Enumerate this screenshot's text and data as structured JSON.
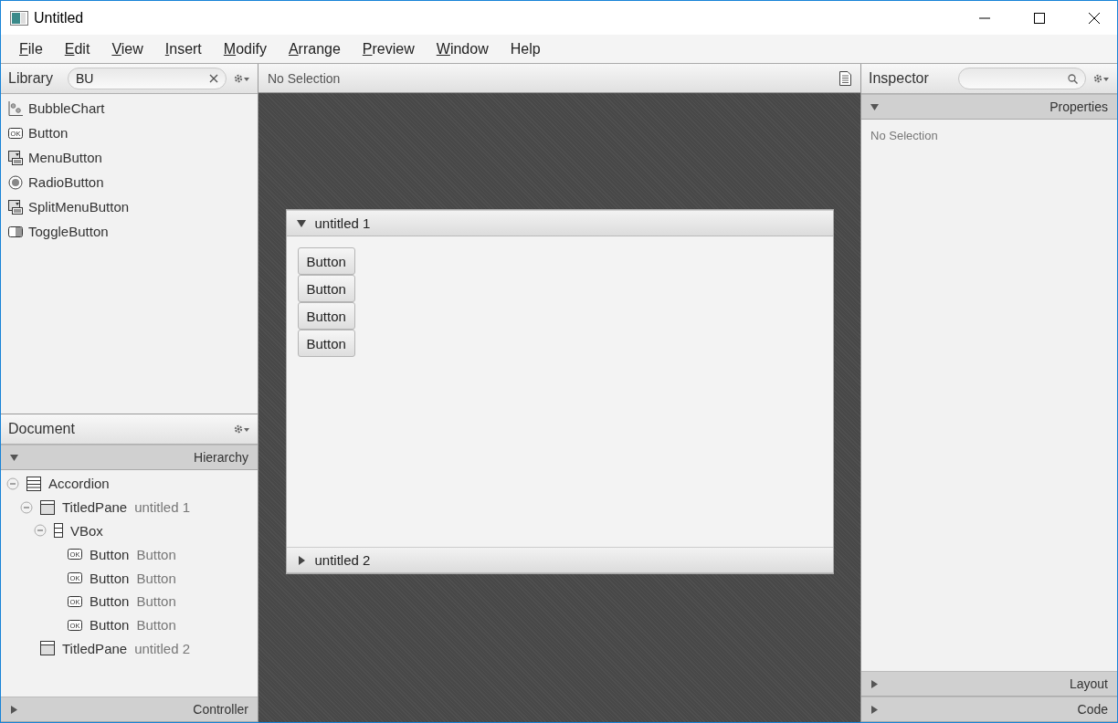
{
  "window": {
    "title": "Untitled"
  },
  "menu": [
    {
      "label": "File",
      "underlined": true
    },
    {
      "label": "Edit",
      "underlined": true
    },
    {
      "label": "View",
      "underlined": true
    },
    {
      "label": "Insert",
      "underlined": true
    },
    {
      "label": "Modify",
      "underlined": true
    },
    {
      "label": "Arrange",
      "underlined": true
    },
    {
      "label": "Preview",
      "underlined": true
    },
    {
      "label": "Window",
      "underlined": true
    },
    {
      "label": "Help",
      "underlined": false
    }
  ],
  "library": {
    "title": "Library",
    "search": {
      "value": "BU"
    },
    "items": [
      {
        "label": "BubbleChart",
        "kind": "chart"
      },
      {
        "label": "Button",
        "kind": "ok",
        "icon_text": "OK"
      },
      {
        "label": "MenuButton",
        "kind": "menu"
      },
      {
        "label": "RadioButton",
        "kind": "radio"
      },
      {
        "label": "SplitMenuButton",
        "kind": "menu"
      },
      {
        "label": "ToggleButton",
        "kind": "toggle"
      }
    ]
  },
  "document": {
    "title": "Document",
    "sections": [
      {
        "label": "Hierarchy",
        "expanded": true
      },
      {
        "label": "Controller",
        "expanded": false
      }
    ],
    "tree": [
      {
        "type": "Accordion",
        "kind": "accordion",
        "expanded": true,
        "children": [
          {
            "type": "TitledPane",
            "label": "untitled 1",
            "kind": "pane",
            "expanded": true,
            "children": [
              {
                "type": "VBox",
                "kind": "vbox",
                "expanded": true,
                "children": [
                  {
                    "type": "Button",
                    "label": "Button",
                    "kind": "ok",
                    "icon_text": "OK"
                  },
                  {
                    "type": "Button",
                    "label": "Button",
                    "kind": "ok",
                    "icon_text": "OK"
                  },
                  {
                    "type": "Button",
                    "label": "Button",
                    "kind": "ok",
                    "icon_text": "OK"
                  },
                  {
                    "type": "Button",
                    "label": "Button",
                    "kind": "ok",
                    "icon_text": "OK"
                  }
                ]
              }
            ]
          },
          {
            "type": "TitledPane",
            "label": "untitled 2",
            "kind": "pane"
          }
        ]
      }
    ]
  },
  "canvas": {
    "status": "No Selection",
    "accordion": [
      {
        "title": "untitled 1",
        "expanded": true,
        "buttons": [
          "Button",
          "Button",
          "Button",
          "Button"
        ]
      },
      {
        "title": "untitled 2",
        "expanded": false
      }
    ]
  },
  "inspector": {
    "title": "Inspector",
    "sections": [
      {
        "label": "Properties",
        "expanded": true,
        "message": "No Selection"
      },
      {
        "label": "Layout",
        "expanded": false
      },
      {
        "label": "Code",
        "expanded": false
      }
    ]
  }
}
